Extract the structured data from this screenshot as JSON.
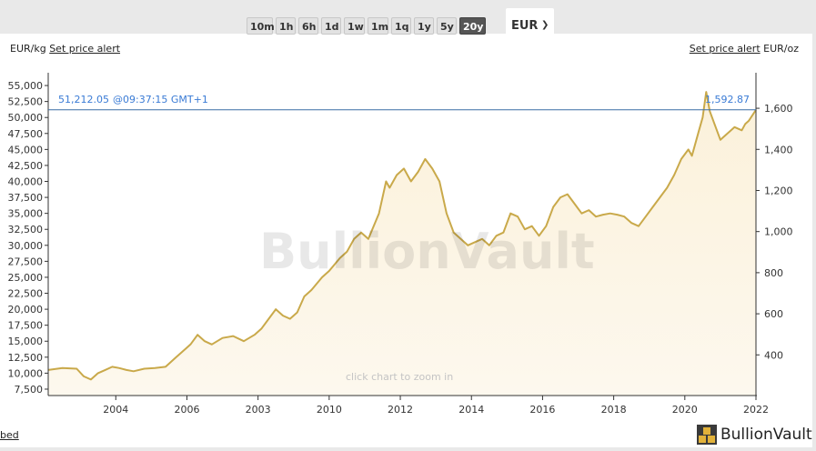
{
  "range_buttons": [
    "10m",
    "1h",
    "6h",
    "1d",
    "1w",
    "1m",
    "1q",
    "1y",
    "5y",
    "20y"
  ],
  "active_range": "20y",
  "currency": "EUR",
  "left_unit": "EUR/kg",
  "right_unit": "EUR/oz",
  "set_alert_label": "Set price alert",
  "current_price_kg": "51,212.05",
  "current_time": "@09:37:15 GMT+1",
  "current_price_oz": "1,592.87",
  "watermark": "BullionVault",
  "zoom_hint": "click chart to zoom in",
  "embed_label": "bed",
  "brand_name": "BullionVault",
  "colors": {
    "line": "#c9a94a",
    "fill": "#fbf1da",
    "current_line": "#3a6ea5",
    "current_text": "#3a7bd5"
  },
  "chart_data": {
    "type": "area",
    "x_tick_labels": [
      "2004",
      "2006",
      "2003",
      "2010",
      "2012",
      "2014",
      "2016",
      "2018",
      "2020",
      "2022"
    ],
    "y_left_ticks": [
      "7,500",
      "10,000",
      "12,500",
      "15,000",
      "17,500",
      "20,000",
      "22,500",
      "25,000",
      "27,500",
      "30,000",
      "32,500",
      "35,000",
      "37,500",
      "40,000",
      "42,500",
      "45,000",
      "47,500",
      "50,000",
      "52,500",
      "55,000"
    ],
    "y_left_range": [
      6500,
      57000
    ],
    "y_right_ticks": [
      "400",
      "600",
      "800",
      "1,000",
      "1,200",
      "1,400",
      "1,600"
    ],
    "x_range": [
      2002.1,
      2022.0
    ],
    "grid": false,
    "current_value_kg": 51212.05,
    "x": [
      2002.1,
      2002.5,
      2002.9,
      2003.1,
      2003.3,
      2003.5,
      2003.7,
      2003.9,
      2004.1,
      2004.3,
      2004.5,
      2004.8,
      2005.1,
      2005.4,
      2005.7,
      2005.9,
      2006.1,
      2006.3,
      2006.5,
      2006.7,
      2007.0,
      2007.3,
      2007.6,
      2007.9,
      2008.1,
      2008.3,
      2008.5,
      2008.7,
      2008.9,
      2009.1,
      2009.3,
      2009.5,
      2009.8,
      2010.0,
      2010.3,
      2010.5,
      2010.7,
      2010.9,
      2011.1,
      2011.4,
      2011.6,
      2011.7,
      2011.9,
      2012.1,
      2012.3,
      2012.5,
      2012.7,
      2012.9,
      2013.1,
      2013.3,
      2013.5,
      2013.7,
      2013.9,
      2014.1,
      2014.3,
      2014.5,
      2014.7,
      2014.9,
      2015.1,
      2015.3,
      2015.5,
      2015.7,
      2015.9,
      2016.1,
      2016.3,
      2016.5,
      2016.7,
      2016.9,
      2017.1,
      2017.3,
      2017.5,
      2017.7,
      2017.9,
      2018.1,
      2018.3,
      2018.5,
      2018.7,
      2018.9,
      2019.1,
      2019.3,
      2019.5,
      2019.7,
      2019.9,
      2020.1,
      2020.2,
      2020.4,
      2020.5,
      2020.6,
      2020.7,
      2020.9,
      2021.0,
      2021.2,
      2021.4,
      2021.6,
      2021.7,
      2021.8,
      2022.0
    ],
    "values": [
      10500,
      10800,
      10700,
      9500,
      9000,
      10000,
      10500,
      11000,
      10800,
      10500,
      10300,
      10700,
      10800,
      11000,
      12500,
      13500,
      14500,
      16000,
      15000,
      14500,
      15500,
      15800,
      15000,
      16000,
      17000,
      18500,
      20000,
      19000,
      18500,
      19500,
      22000,
      23000,
      25000,
      26000,
      28000,
      29000,
      31000,
      32000,
      31000,
      35000,
      40000,
      39000,
      41000,
      42000,
      40000,
      41500,
      43500,
      42000,
      40000,
      35000,
      32000,
      31000,
      30000,
      30500,
      31000,
      30000,
      31500,
      32000,
      35000,
      34500,
      32500,
      33000,
      31500,
      33000,
      36000,
      37500,
      38000,
      36500,
      35000,
      35500,
      34500,
      34800,
      35000,
      34800,
      34500,
      33500,
      33000,
      34500,
      36000,
      37500,
      39000,
      41000,
      43500,
      45000,
      44000,
      48000,
      50000,
      54000,
      51000,
      48000,
      46500,
      47500,
      48500,
      48000,
      49000,
      49500,
      51200
    ]
  }
}
